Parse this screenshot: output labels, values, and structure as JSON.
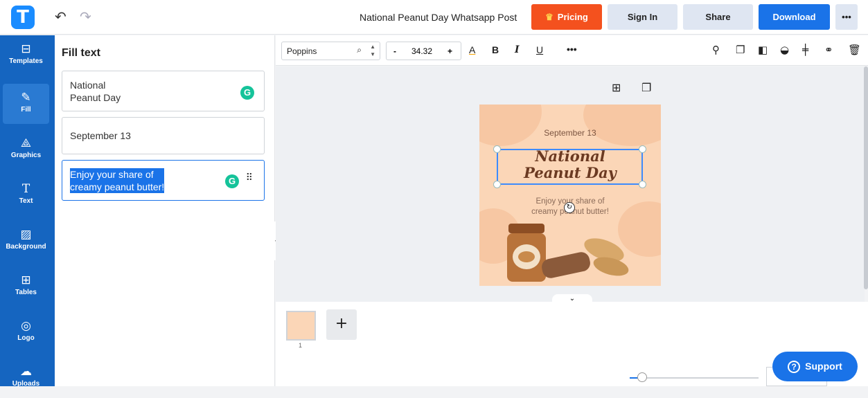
{
  "header": {
    "logo_letter": "T",
    "undo_icon": "undo-icon",
    "redo_icon": "redo-icon",
    "document_title": "National Peanut Day Whatsapp Post",
    "pricing_label": "Pricing",
    "signin_label": "Sign In",
    "share_label": "Share",
    "download_label": "Download",
    "more_label": "•••",
    "colors": {
      "pricing": "#f4511e",
      "download": "#1a73e8",
      "neutral": "#dfe6f2"
    }
  },
  "sidebar": {
    "items": [
      {
        "label": "Templates",
        "icon": "templates-icon",
        "glyph": "⊞"
      },
      {
        "label": "Fill",
        "icon": "pencil-icon",
        "glyph": "✎"
      },
      {
        "label": "Graphics",
        "icon": "shapes-icon",
        "glyph": "△"
      },
      {
        "label": "Text",
        "icon": "text-icon",
        "glyph": "T"
      },
      {
        "label": "Background",
        "icon": "background-icon",
        "glyph": "▨"
      },
      {
        "label": "Tables",
        "icon": "table-icon",
        "glyph": "⊞"
      },
      {
        "label": "Logo",
        "icon": "logo-icon",
        "glyph": "◎"
      },
      {
        "label": "Uploads",
        "icon": "upload-icon",
        "glyph": "☁"
      }
    ],
    "active": "Fill",
    "color": "#1565c0"
  },
  "panel": {
    "title": "Fill text",
    "fields": [
      {
        "value": "National\nPeanut Day"
      },
      {
        "value": "September 13"
      },
      {
        "value": "Enjoy your share of\ncreamy peanut butter!"
      }
    ]
  },
  "format_bar": {
    "font": "Poppins",
    "font_size": "34.32",
    "minus": "-",
    "plus": "+",
    "underline_color_A": "A",
    "bold": "B",
    "italic": "I",
    "underline": "U",
    "more": "•••"
  },
  "design": {
    "date": "September 13",
    "title": "National\nPeanut Day",
    "body": "Enjoy your share of\ncreamy peanut butter!",
    "background_color": "#fbd6b7"
  },
  "pages": {
    "current_page_number": "1"
  },
  "support": {
    "label": "Support"
  }
}
